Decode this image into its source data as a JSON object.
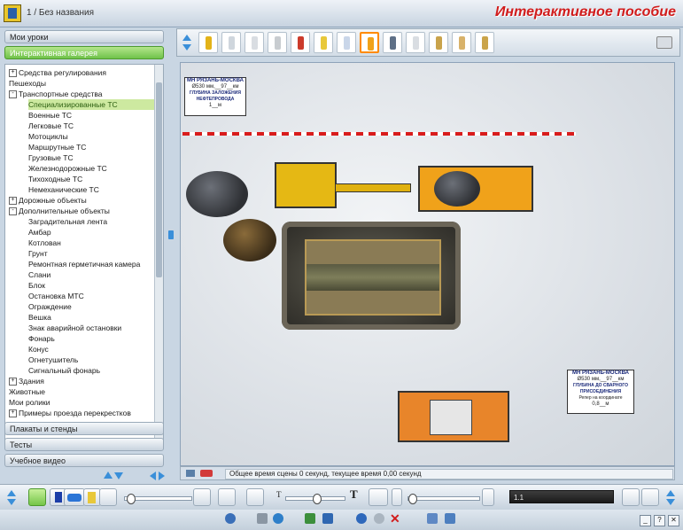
{
  "titlebar": {
    "doc_title": "1 / Без названия",
    "app_title": "Интерактивное пособие"
  },
  "left_panel": {
    "top_tabs": [
      {
        "label": "Мои уроки",
        "active": false
      },
      {
        "label": "Интерактивная галерея",
        "active": true
      }
    ],
    "tree": [
      {
        "label": "Средства регулирования",
        "level": 0,
        "toggle": "+"
      },
      {
        "label": "Пешеходы",
        "level": 0,
        "toggle": ""
      },
      {
        "label": "Транспортные средства",
        "level": 0,
        "toggle": "-"
      },
      {
        "label": "Специализированные ТС",
        "level": 1,
        "toggle": "",
        "selected": true
      },
      {
        "label": "Военные ТС",
        "level": 1,
        "toggle": ""
      },
      {
        "label": "Легковые ТС",
        "level": 1,
        "toggle": ""
      },
      {
        "label": "Мотоциклы",
        "level": 1,
        "toggle": ""
      },
      {
        "label": "Маршрутные ТС",
        "level": 1,
        "toggle": ""
      },
      {
        "label": "Грузовые ТС",
        "level": 1,
        "toggle": ""
      },
      {
        "label": "Железнодорожные ТС",
        "level": 1,
        "toggle": ""
      },
      {
        "label": "Тихоходные ТС",
        "level": 1,
        "toggle": ""
      },
      {
        "label": "Немеханические ТС",
        "level": 1,
        "toggle": ""
      },
      {
        "label": "Дорожные объекты",
        "level": 0,
        "toggle": "+"
      },
      {
        "label": "Дополнительные объекты",
        "level": 0,
        "toggle": "-"
      },
      {
        "label": "Заградительная лента",
        "level": 1,
        "toggle": ""
      },
      {
        "label": "Амбар",
        "level": 1,
        "toggle": ""
      },
      {
        "label": "Котлован",
        "level": 1,
        "toggle": ""
      },
      {
        "label": "Грунт",
        "level": 1,
        "toggle": ""
      },
      {
        "label": "Ремонтная герметичная камера",
        "level": 1,
        "toggle": ""
      },
      {
        "label": "Слани",
        "level": 1,
        "toggle": ""
      },
      {
        "label": "Блок",
        "level": 1,
        "toggle": ""
      },
      {
        "label": "Остановка МТС",
        "level": 1,
        "toggle": ""
      },
      {
        "label": "Ограждение",
        "level": 1,
        "toggle": ""
      },
      {
        "label": "Вешка",
        "level": 1,
        "toggle": ""
      },
      {
        "label": "Знак аварийной остановки",
        "level": 1,
        "toggle": ""
      },
      {
        "label": "Фонарь",
        "level": 1,
        "toggle": ""
      },
      {
        "label": "Конус",
        "level": 1,
        "toggle": ""
      },
      {
        "label": "Огнетушитель",
        "level": 1,
        "toggle": ""
      },
      {
        "label": "Сигнальный фонарь",
        "level": 1,
        "toggle": ""
      },
      {
        "label": "Здания",
        "level": 0,
        "toggle": "+"
      },
      {
        "label": "Животные",
        "level": 0,
        "toggle": ""
      },
      {
        "label": "Мои ролики",
        "level": 0,
        "toggle": ""
      },
      {
        "label": "Примеры проезда перекрестков",
        "level": 0,
        "toggle": "+"
      }
    ],
    "bottom_tabs": [
      "Плакаты и стенды",
      "Тесты",
      "Учебное видео"
    ]
  },
  "gallery": {
    "thumbs": [
      {
        "icon": "special-vehicle-icon",
        "color": "#e3b318"
      },
      {
        "icon": "car-white-icon",
        "color": "#cfd6dd"
      },
      {
        "icon": "van-icon",
        "color": "#d9dde2"
      },
      {
        "icon": "truck-white-icon",
        "color": "#c8ccd0"
      },
      {
        "icon": "fire-truck-icon",
        "color": "#cc3b2b"
      },
      {
        "icon": "taxi-icon",
        "color": "#e8c83a"
      },
      {
        "icon": "police-car-icon",
        "color": "#c9d6e9"
      },
      {
        "icon": "dump-truck-icon",
        "color": "#f0a21a",
        "selected": true
      },
      {
        "icon": "crane-icon",
        "color": "#5e6f86"
      },
      {
        "icon": "roller-icon",
        "color": "#d9dde2"
      },
      {
        "icon": "road-roller-icon",
        "color": "#c9a34b"
      },
      {
        "icon": "trailer-icon",
        "color": "#d8b26a"
      },
      {
        "icon": "tractor-icon",
        "color": "#caa44a"
      }
    ]
  },
  "scene": {
    "sign_top": {
      "title": "МН РЯЗАНЬ-МОСКВА",
      "line": "Ø530 мм,__97__км",
      "caption": "ГЛУБИНА ЗАЛОЖЕНИЯ НЕФТЕПРОВОДА",
      "value": "1__м"
    },
    "sign_bottom": {
      "title": "МН РЯЗАНЬ-МОСКВА",
      "line": "Ø530 мм,__97__км",
      "caption": "ГЛУБИНА ДО СВАРНОГО ПРИСОЕДИНЕНИЯ",
      "caption2": "Репер на координате",
      "value": "0,8__м"
    },
    "status_text": "Общее время сцены 0 секунд, текущее время 0,00 секунд"
  },
  "toolbar": {
    "speed_value": "1.1"
  },
  "colors": {
    "accent_green": "#6fc24a",
    "title_red": "#d11c1c",
    "selected_orange": "#ff8a00",
    "nav_blue": "#3a8fd9"
  }
}
